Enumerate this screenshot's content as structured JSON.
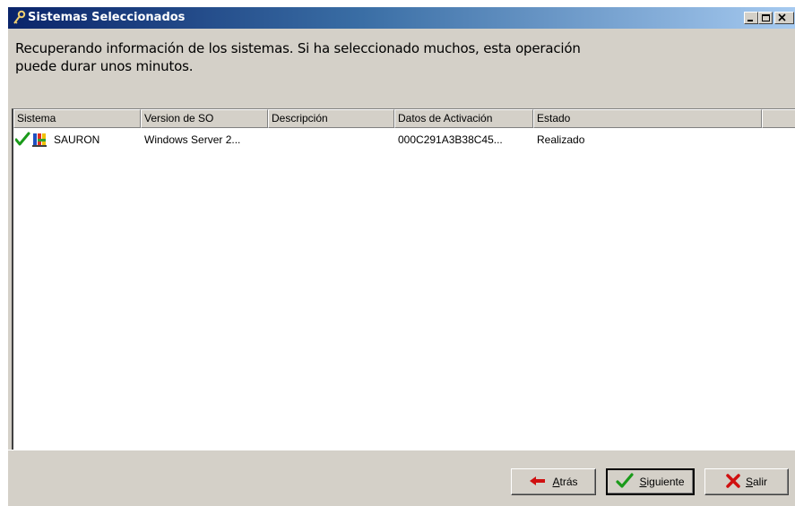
{
  "window": {
    "title": "Sistemas Seleccionados"
  },
  "intro": {
    "line1": "Recuperando información de los sistemas. Si ha seleccionado muchos, esta operación",
    "line2": "puede durar unos minutos."
  },
  "table": {
    "columns": [
      "Sistema",
      "Version de SO",
      "Descripción",
      "Datos de Activación",
      "Estado"
    ],
    "rows": [
      {
        "sistema": "SAURON",
        "version": "Windows Server 2...",
        "descripcion": "",
        "datos": "000C291A3B38C45...",
        "estado": "Realizado",
        "status_icon": "check-icon",
        "system_icon": "windows-server-icon"
      }
    ]
  },
  "buttons": {
    "back": {
      "accel": "A",
      "rest": "trás",
      "icon": "arrow-left-icon"
    },
    "next": {
      "accel": "S",
      "rest": "iguiente",
      "icon": "check-icon"
    },
    "exit": {
      "accel": "S",
      "rest": "alir",
      "icon": "x-icon"
    }
  },
  "colors": {
    "title_start": "#0a246a",
    "title_end": "#a6caf0",
    "check_green": "#1a9a1a",
    "exit_red": "#d01010",
    "back_red": "#d01010"
  }
}
